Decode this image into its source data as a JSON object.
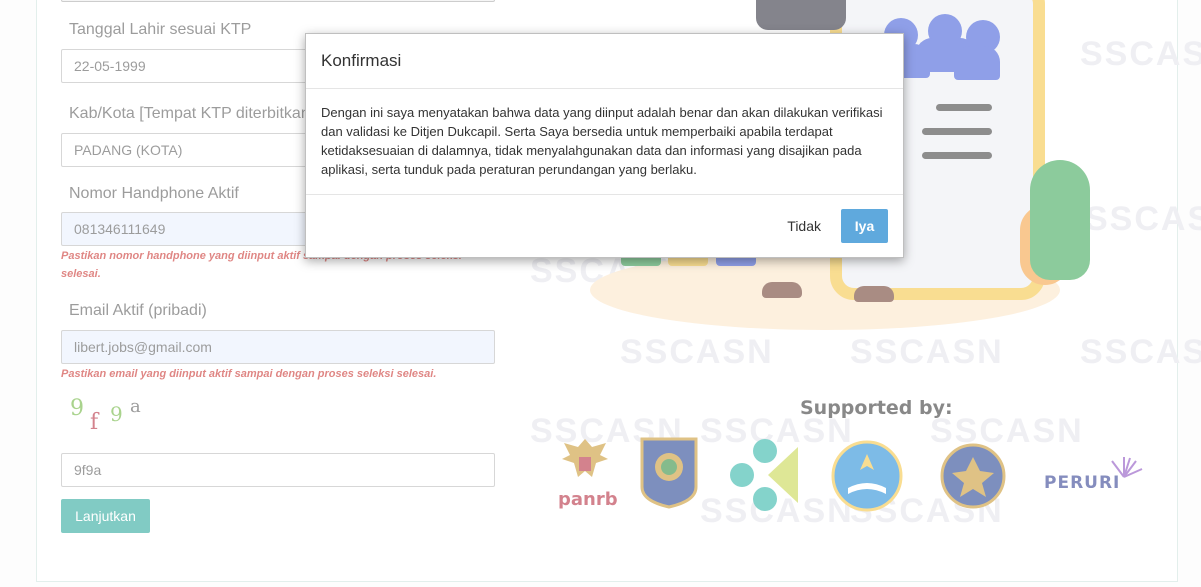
{
  "form": {
    "dob_label": "Tanggal Lahir sesuai KTP",
    "dob_value": "22-05-1999",
    "city_label": "Kab/Kota [Tempat KTP diterbitkan]",
    "city_value": "PADANG (KOTA)",
    "phone_label": "Nomor Handphone Aktif",
    "phone_value": "081346111649",
    "phone_hint": "Pastikan nomor handphone yang diinput aktif sampai dengan proses seleksi selesai.",
    "email_label": "Email Aktif (pribadi)",
    "email_value": "libert.jobs@gmail.com",
    "email_hint": "Pastikan email yang diinput aktif sampai dengan proses seleksi selesai.",
    "captcha_chars": [
      "9",
      "f",
      "9",
      "a"
    ],
    "captcha_value": "9f9a",
    "submit_label": "Lanjutkan"
  },
  "illustration": {
    "watermark_text": "SSCASN",
    "supported_by": "Supported by:",
    "logos": [
      {
        "name": "panrb",
        "text": "panrb"
      },
      {
        "name": "bkn",
        "text": ""
      },
      {
        "name": "kemenkes",
        "text": ""
      },
      {
        "name": "tut-wuri-handayani",
        "text": ""
      },
      {
        "name": "bssn",
        "text": ""
      },
      {
        "name": "peruri",
        "text": "PERURI"
      }
    ]
  },
  "modal": {
    "title": "Konfirmasi",
    "body": "Dengan ini saya menyatakan bahwa data yang diinput adalah benar dan akan dilakukan verifikasi dan validasi ke Ditjen Dukcapil. Serta Saya bersedia untuk memperbaiki apabila terdapat ketidaksesuaian di dalamnya, tidak menyalahgunakan data dan informasi yang disajikan pada aplikasi, serta tunduk pada peraturan perundangan yang berlaku.",
    "cancel_label": "Tidak",
    "confirm_label": "Iya"
  },
  "colors": {
    "primary_button": "#26a69a",
    "confirm_button": "#5fa9dd",
    "hint_text": "#c9302c",
    "autofill_bg": "#e8f0fe"
  }
}
